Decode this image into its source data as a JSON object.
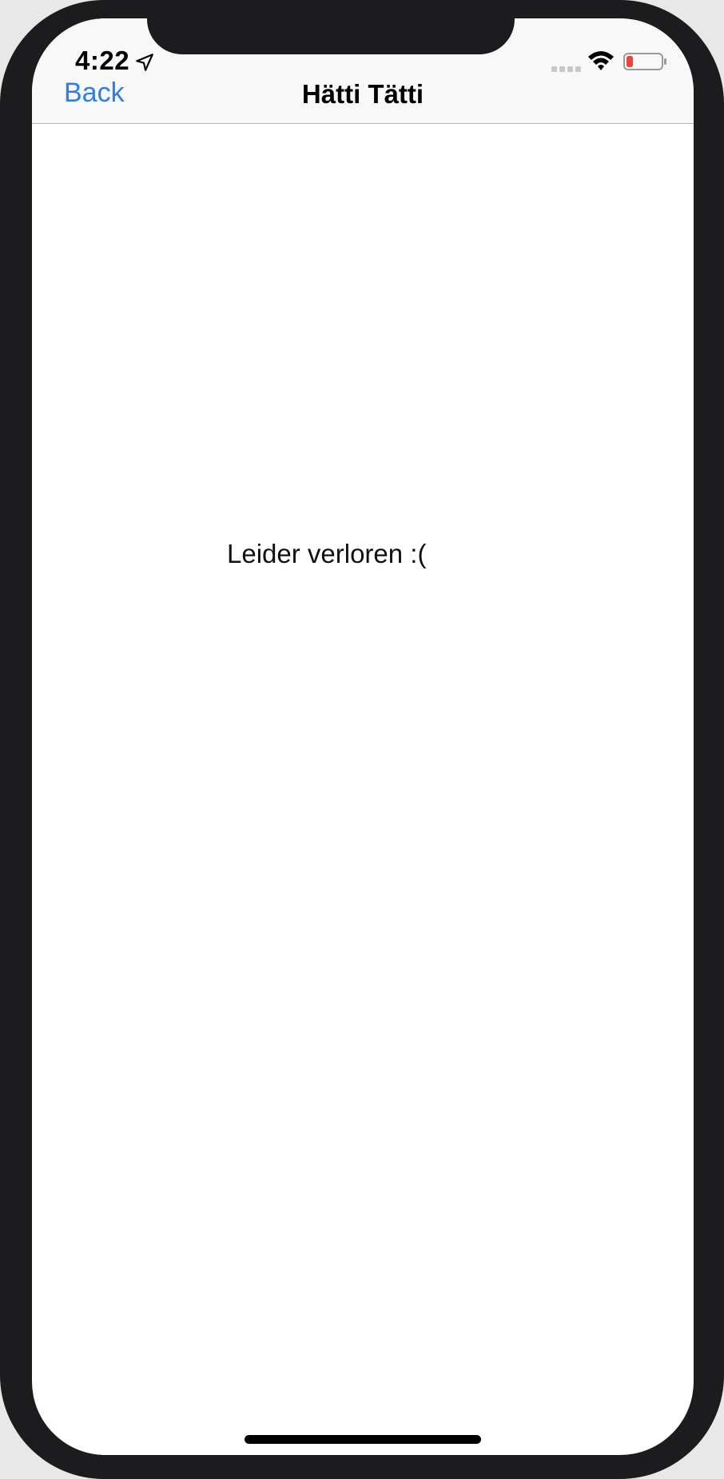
{
  "status_bar": {
    "time": "4:22",
    "battery_color": "#e8463a"
  },
  "nav": {
    "back_label": "Back",
    "title": "Hätti Tätti",
    "back_color": "#2f7ee0"
  },
  "content": {
    "message": "Leider verloren :("
  },
  "icons": {
    "location": "location-arrow-icon",
    "signal": "cellular-signal-icon",
    "wifi": "wifi-icon",
    "battery": "battery-low-icon"
  }
}
